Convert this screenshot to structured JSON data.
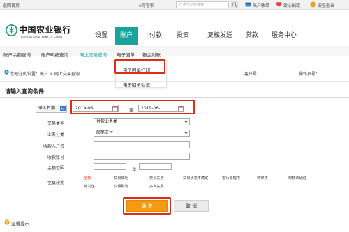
{
  "colors": {
    "accent": "#1aa39a",
    "highlight_box": "#e12b16",
    "confirm_button": "#f39a11",
    "status_active": "#e02a12"
  },
  "utilbar": {
    "home": "返回首页",
    "epay": "e商管家",
    "search_placeholder": "产品与功能搜索",
    "items": [
      "账户收单",
      "爱心捐款",
      "安全退出"
    ]
  },
  "brand": {
    "name_cn": "中国农业银行",
    "name_en": "AGRICULTURAL BANK OF CHINA"
  },
  "nav": {
    "items": [
      "设置",
      "账户",
      "付款",
      "投资",
      "复核发送",
      "贷款",
      "服务中心"
    ],
    "active_index": 1
  },
  "subnav": {
    "items": [
      "账户余额查询",
      "账户明细查询",
      "网上交易查询",
      "电子回单",
      "银企对账"
    ],
    "active_index": 2
  },
  "dropdown": {
    "items": [
      "电子回单打印",
      "电子回单验证"
    ]
  },
  "breadcrumb": {
    "text": "您现在的位置：账户 > 网上交易查询",
    "account_label": "客户号：",
    "operator_label": "操作员号："
  },
  "query": {
    "title": "请输入查询条件",
    "date_type": "录入日期",
    "start_date": "2019-06-",
    "to": "至",
    "end_date": "2019-06-",
    "fields": {
      "trade_type": {
        "label": "交易类型",
        "value": "付款业务类"
      },
      "biz_type": {
        "label": "业务分类",
        "value": "邮笔支付"
      },
      "payee_name": {
        "label": "收款人户名"
      },
      "payee_account": {
        "label": "收款账号"
      },
      "amount": {
        "label": "金额范围",
        "to": "至"
      },
      "status": {
        "label": "交易状态"
      }
    },
    "status_row1": [
      "全部",
      "交易成功",
      "交易失败",
      "交易状态不确定",
      "银行处理中",
      "待审核",
      "审核未通过"
    ],
    "status_row2": [
      "待发送",
      "交易取消",
      "多人失败"
    ],
    "status_active_index": 0
  },
  "buttons": {
    "confirm": "确 定",
    "cancel": "取 消"
  },
  "footer": {
    "tips": "温馨提示"
  }
}
